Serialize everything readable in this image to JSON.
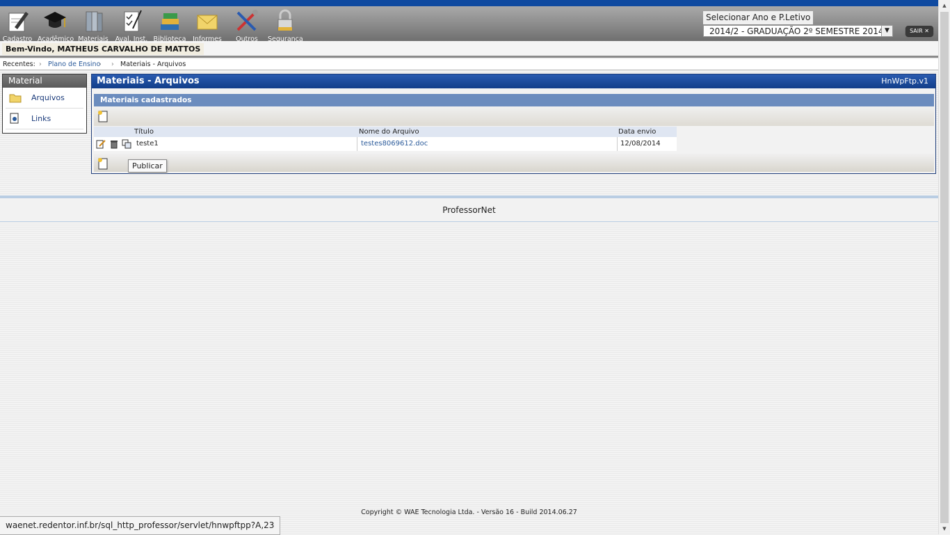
{
  "menu": [
    {
      "label": "Cadastro",
      "icon": "pencil-paper-icon"
    },
    {
      "label": "Acadêmico",
      "icon": "graduation-cap-icon"
    },
    {
      "label": "Materiais",
      "icon": "books-icon"
    },
    {
      "label": "Aval. Inst.",
      "icon": "checklist-icon"
    },
    {
      "label": "Biblioteca",
      "icon": "library-books-icon"
    },
    {
      "label": "Informes",
      "icon": "envelope-icon"
    },
    {
      "label": "Outros",
      "icon": "tools-icon"
    },
    {
      "label": "Segurança",
      "icon": "padlock-icon"
    }
  ],
  "period": {
    "label": "Selecionar Ano e P.Letivo",
    "selected": "2014/2 - GRADUAÇÃO 2º SEMESTRE 2014"
  },
  "logout_label": "SAIR ✕",
  "welcome": "Bem-Vindo, MATHEUS CARVALHO DE MATTOS",
  "recent": {
    "label": "Recentes:",
    "items": [
      "Plano de Ensino",
      "Materiais - Arquivos"
    ]
  },
  "sidebar": {
    "title": "Material",
    "items": [
      {
        "label": "Arquivos",
        "icon": "folder-icon"
      },
      {
        "label": "Links",
        "icon": "link-icon"
      }
    ]
  },
  "panel": {
    "title": "Materiais - Arquivos",
    "version": "HnWpFtp.v1",
    "section_title": "Materiais cadastrados"
  },
  "table": {
    "headers": [
      "Título",
      "Nome do Arquivo",
      "Data envio"
    ],
    "rows": [
      {
        "titulo": "teste1",
        "arquivo": "testes8069612.doc",
        "data": "12/08/2014"
      }
    ]
  },
  "tooltip": "Publicar",
  "footer": {
    "brand": "ProfessorNet",
    "copyright": "Copyright © WAE Tecnologia Ltda. - Versão 16 - Build 2014.06.27"
  },
  "status_url": "waenet.redentor.inf.br/sql_http_professor/servlet/hnwpftpp?A,23",
  "colors": {
    "top_accent": "#0f4aa0",
    "panel_header": "#123e8a",
    "section_header": "#6b8cbe",
    "link": "#2a5a9a"
  }
}
